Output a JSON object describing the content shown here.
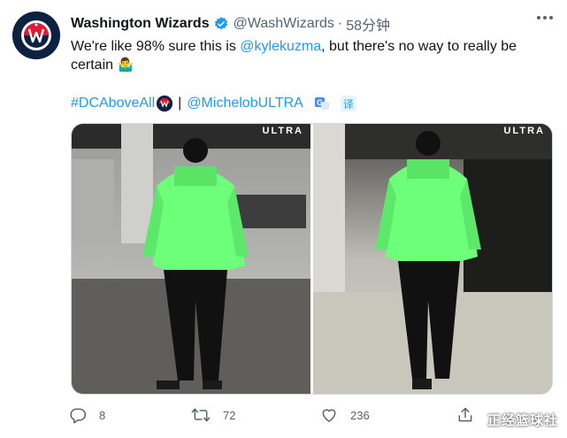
{
  "tweet": {
    "display_name": "Washington Wizards",
    "handle": "@WashWizards",
    "separator": "·",
    "time": "58分钟",
    "text_before": "We're like 98% sure this is ",
    "text_mention": "@kylekuzma",
    "text_after": ", but there's no way to really be certain ",
    "text_emoji": "🤷‍♂️",
    "hashtag": "#DCAboveAll",
    "tag_separator": "|",
    "sponsor_mention": "@MichelobULTRA",
    "translate_label": "译"
  },
  "media": {
    "left_watermark": "ULTRA",
    "right_watermark": "ULTRA"
  },
  "actions": {
    "reply_count": "8",
    "retweet_count": "72",
    "like_count": "236"
  },
  "watermark": "正经篮球社",
  "colors": {
    "link": "#1d9bf0",
    "muted": "#536471",
    "team_navy": "#0d2240",
    "team_red": "#e31837",
    "jacket_green": "#6dff7a"
  }
}
